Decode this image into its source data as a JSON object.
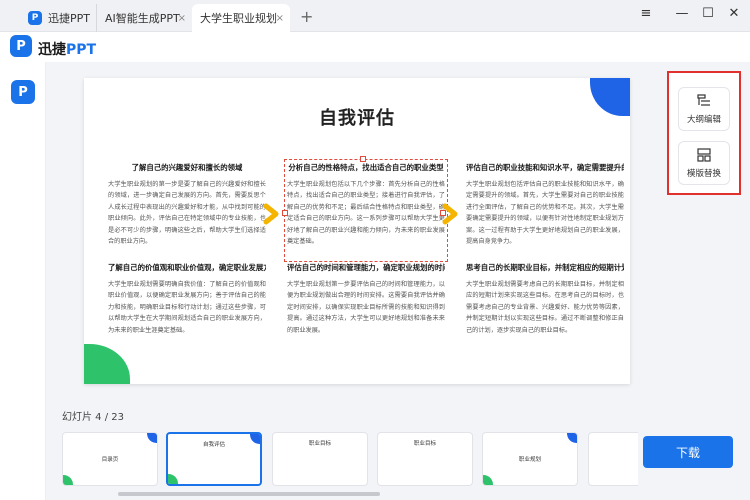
{
  "tabs": [
    {
      "label": "迅捷PPT"
    },
    {
      "label": "AI智能生成PPT"
    },
    {
      "label": "大学生职业规划"
    }
  ],
  "tab_close_glyph": "×",
  "add_tab_glyph": "+",
  "window_controls": {
    "menu": "≡",
    "minimize": "—",
    "maximize": "☐",
    "close": "✕"
  },
  "brand": {
    "logo_letter": "P",
    "name_main": "迅捷",
    "name_suffix": "PPT"
  },
  "slide": {
    "title": "自我评估",
    "cells": [
      {
        "heading": "了解自己的兴趣爱好和擅长的领域",
        "body": "大学生职业规划的第一步是要了解自己的兴趣爱好和擅长的领域，进一步确定自己发展的方向。首先，需要反思个人成长过程中表现出的兴趣爱好和才能，从中找到可能的职业倾向。此外，评估自己在特定领域中的专业技能，也是必不可少的步骤，明确这些之后，帮助大学生们选择适合的职业方向。"
      },
      {
        "heading": "分析自己的性格特点，找出适合自己的职业类型",
        "body": "大学生职业规划包括以下几个步骤：首先分析自己的性格特点，找出适合自己的职业类型；接着进行自我评估，了解自己的优势和不足；最后结合性格特点和职业类型，确定适合自己的职业方向。这一系列步骤可以帮助大学生更好地了解自己的职业兴趣和能力倾向，为未来的职业发展奠定基础。"
      },
      {
        "heading": "评估自己的职业技能和知识水平，确定需要提升的领域",
        "body": "大学生职业规划包括评估自己的职业技能和知识水平，确定需要提升的领域。首先，大学生需要对自己的职业技能进行全面评估，了解自己的优势和不足。其次，大学生需要确定需要提升的领域，以便有针对性地制定职业规划方案。这一过程有助于大学生更好地规划自己的职业发展，提高自身竞争力。"
      },
      {
        "heading": "了解自己的价值观和职业价值观，确定职业发展方向",
        "body": "大学生职业规划需要明确自我价值：了解自己的价值观和职业价值观，以便确定职业发展方向；善于评估自己的能力和技能，明确职业目标和行动计划；通过这些步骤，可以帮助大学生在大学期间规划适合自己的职业发展方向，为未来的职业生涯奠定基础。"
      },
      {
        "heading": "评估自己的时间和管理能力，确定职业规划的时间安排",
        "body": "大学生职业规划第一步要评估自己的时间和管理能力，以便为职业规划做出合理的时间安排。这需要自我评估并确定时间安排，以确保实现职业目标所需的技能和知识得到提高。通过这种方法，大学生可以更好地规划和准备未来的职业发展。"
      },
      {
        "heading": "思考自己的长期职业目标，并制定相应的短期计划来实现这些目标",
        "body": "大学生职业规划需要考虑自己的长期职业目标，并制定相应的短期计划来实现这些目标。在思考自己的目标时，也需要考虑自己的专业背景、兴趣爱好、能力优势等因素，并制定短期计划以实现这些目标。通过不断调整和修正自己的计划，逐步实现自己的职业目标。"
      }
    ]
  },
  "side_panel": {
    "outline_edit_label": "大纲编辑",
    "template_replace_label": "模版替换"
  },
  "filmstrip": {
    "counter": "幻灯片 4 / 23",
    "thumbs": [
      {
        "title": "目录页"
      },
      {
        "title": "自我评估"
      },
      {
        "title": "职业目标"
      },
      {
        "title": "职业目标"
      },
      {
        "title": "职业规划"
      },
      {
        "title": ""
      }
    ]
  },
  "download_label": "下载",
  "colors": {
    "accent": "#1a73e8",
    "slide_blue": "#1f63e6",
    "slide_green": "#2ec26a",
    "arrow_yellow": "#f5b400",
    "highlight_red": "#e0312f"
  }
}
